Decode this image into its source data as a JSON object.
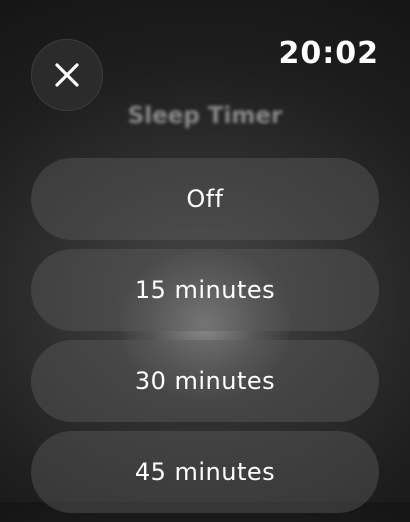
{
  "status_bar": {
    "time": "20:02"
  },
  "header": {
    "close_icon": "close-icon",
    "title": "Sleep Timer"
  },
  "options": [
    {
      "label": "Off"
    },
    {
      "label": "15 minutes"
    },
    {
      "label": "30 minutes"
    },
    {
      "label": "45 minutes"
    }
  ],
  "colors": {
    "background": "#1e1e1e",
    "button_fill": "#3a3a3a",
    "text": "#ffffff",
    "title_text": "#9a9a9a"
  }
}
